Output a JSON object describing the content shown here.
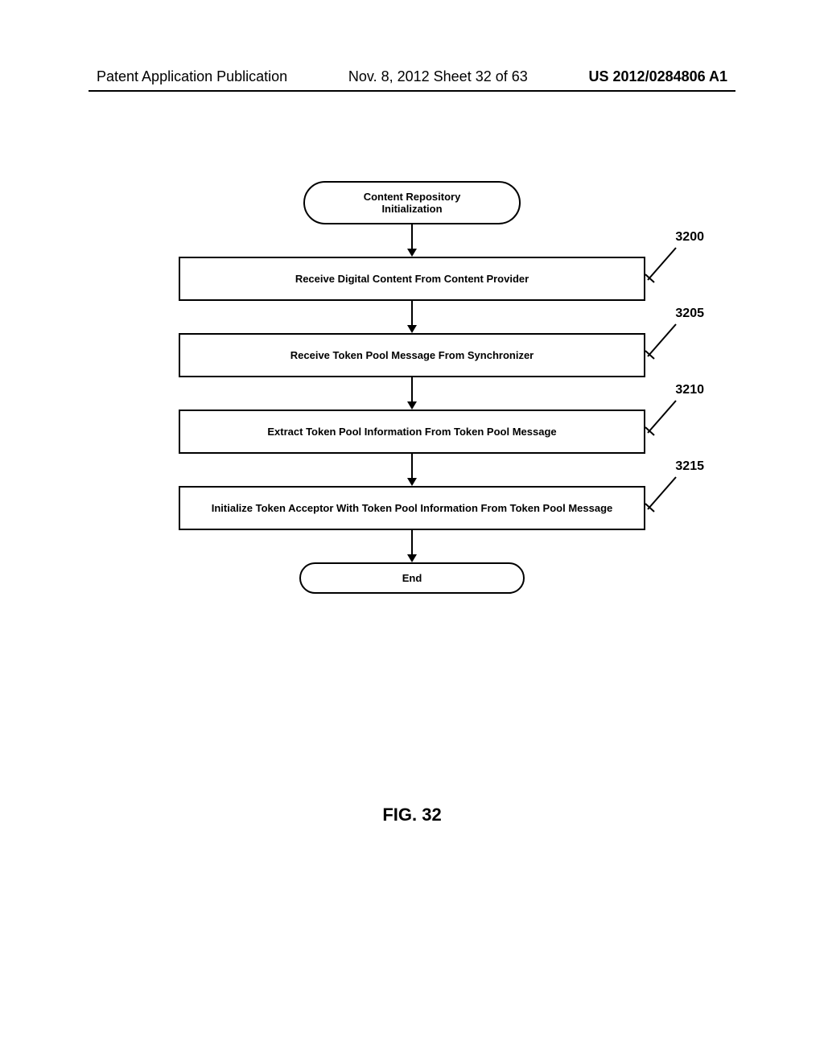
{
  "header": {
    "left": "Patent Application Publication",
    "center": "Nov. 8, 2012  Sheet 32 of 63",
    "right": "US 2012/0284806 A1"
  },
  "flowchart": {
    "start": "Content Repository\nInitialization",
    "steps": [
      {
        "label": "Receive Digital Content From Content Provider",
        "ref": "3200"
      },
      {
        "label": "Receive Token Pool Message From Synchronizer",
        "ref": "3205"
      },
      {
        "label": "Extract Token Pool Information From Token Pool Message",
        "ref": "3210"
      },
      {
        "label": "Initialize Token Acceptor With Token Pool Information From Token Pool Message",
        "ref": "3215"
      }
    ],
    "end": "End"
  },
  "figure": "FIG. 32"
}
